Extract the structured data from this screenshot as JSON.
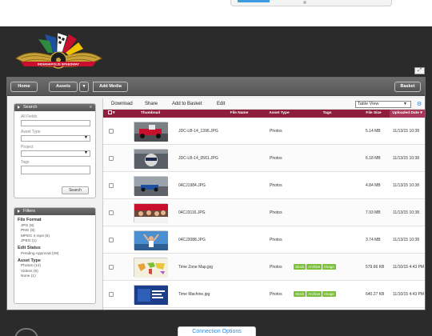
{
  "nav": {
    "home": "Home",
    "assets": "Assets",
    "caret": "▾",
    "add_media": "Add Media",
    "basket": "Basket"
  },
  "search_panel": {
    "title": "Search",
    "all_fields_label": "All Fields",
    "asset_type_label": "Asset Type",
    "project_label": "Project",
    "tags_label": "Tags",
    "search_button": "Search"
  },
  "filters_panel": {
    "title": "Filters",
    "groups": [
      {
        "title": "File Format",
        "items": [
          "JPG (8)",
          "PNG (8)",
          "MPEG 4 mp4 (5)",
          "JPEG (1)"
        ]
      },
      {
        "title": "Edit Status",
        "items": [
          "Pending Approval (28)"
        ]
      },
      {
        "title": "Asset Type",
        "items": [
          "Photos (14)",
          "Videos (5)",
          "None (1)"
        ]
      }
    ]
  },
  "toolbar": {
    "download": "Download",
    "share": "Share",
    "add_to_basket": "Add to Basket",
    "edit": "Edit",
    "view": "Table View"
  },
  "table": {
    "columns": [
      "Thumbnail",
      "File Name",
      "Asset Type",
      "Tags",
      "File Size",
      "Uploaded Date"
    ],
    "rows": [
      {
        "file_name": "JDC-LB-14_1396.JPG",
        "asset_type": "Photos",
        "tags": [],
        "file_size": "5.14 MB",
        "uploaded": "11/13/15 10:38 AM",
        "thumb": "race-car-pit"
      },
      {
        "file_name": "JDC-LB-14_0561.JPG",
        "asset_type": "Photos",
        "tags": [],
        "file_size": "6.18 MB",
        "uploaded": "11/13/15 10:38 AM",
        "thumb": "driver-helmet"
      },
      {
        "file_name": "04CJ1984.JPG",
        "asset_type": "Photos",
        "tags": [],
        "file_size": "4.84 MB",
        "uploaded": "11/13/15 10:38 AM",
        "thumb": "car-on-track"
      },
      {
        "file_name": "04CJ3116.JPG",
        "asset_type": "Photos",
        "tags": [],
        "file_size": "7.93 MB",
        "uploaded": "11/13/15 10:38 AM",
        "thumb": "crowd-celebration"
      },
      {
        "file_name": "04CJ3088.JPG",
        "asset_type": "Photos",
        "tags": [],
        "file_size": "3.74 MB",
        "uploaded": "11/13/15 10:38 AM",
        "thumb": "victory-arms"
      },
      {
        "file_name": "Time Zone Map.jpg",
        "asset_type": "Photos",
        "tags": [
          "Stock",
          "Archive",
          "Image"
        ],
        "file_size": "579.66 KB",
        "uploaded": "11/10/15 4:43 PM",
        "thumb": "world-map"
      },
      {
        "file_name": "Time Machine.jpg",
        "asset_type": "Photos",
        "tags": [
          "Stock",
          "Archive",
          "Image"
        ],
        "file_size": "640.27 KB",
        "uploaded": "11/10/15 4:43 PM",
        "thumb": "blue-screen"
      }
    ]
  },
  "footer": {
    "connection_options": "Connection Options"
  },
  "colors": {
    "header_bar": "#8e1e3c",
    "tag_green": "#7cbf3a",
    "link_blue": "#2a8be0"
  }
}
